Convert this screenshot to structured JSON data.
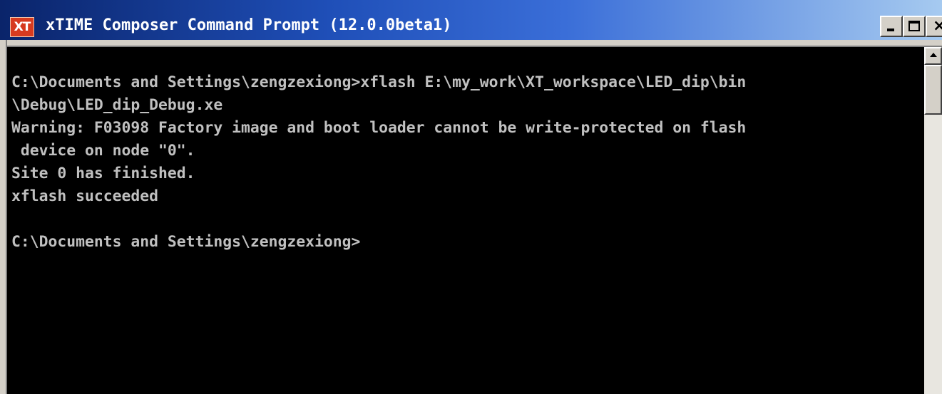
{
  "window": {
    "icon_label": "XT",
    "title": "xTIME Composer Command Prompt (12.0.0beta1)",
    "title_color": "#ffffff",
    "titlebar_color": "#0a246a"
  },
  "caption_buttons": {
    "minimize": "minimize-icon",
    "maximize": "maximize-icon",
    "close": "close-icon",
    "close_glyph": "×"
  },
  "console": {
    "background": "#000000",
    "text_color": "#c0c0c0",
    "lines": [
      "C:\\Documents and Settings\\zengzexiong>xflash E:\\my_work\\XT_workspace\\LED_dip\\bin",
      "\\Debug\\LED_dip_Debug.xe",
      "Warning: F03098 Factory image and boot loader cannot be write-protected on flash",
      " device on node \"0\".",
      "Site 0 has finished.",
      "xflash succeeded",
      "",
      "C:\\Documents and Settings\\zengzexiong>"
    ]
  },
  "scrollbar": {
    "up_arrow": "scroll-up-arrow-icon"
  }
}
